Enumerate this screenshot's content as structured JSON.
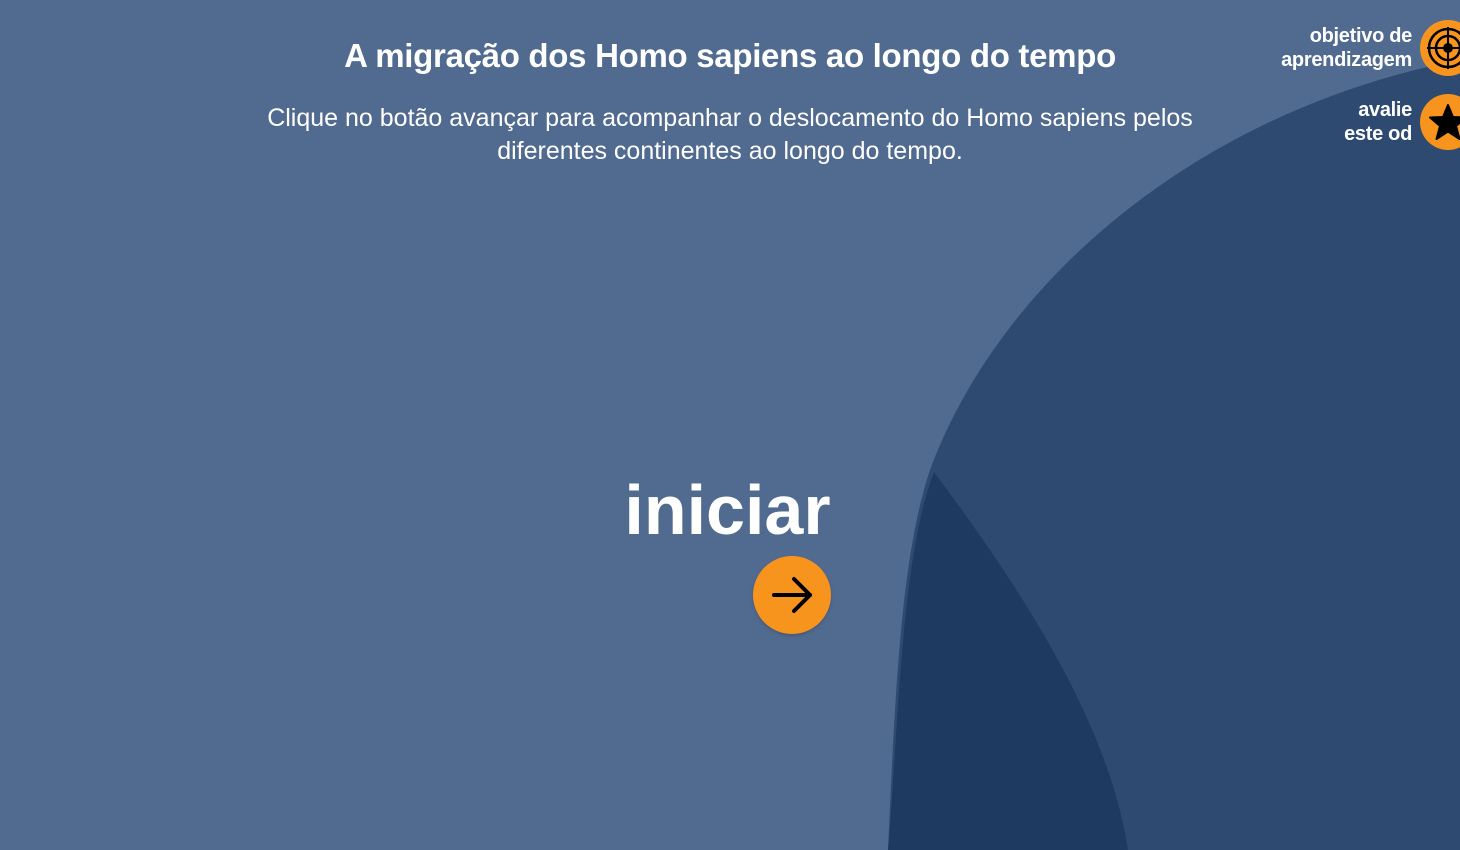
{
  "header": {
    "title": "A migração dos Homo sapiens ao longo do tempo",
    "instructions": "Clique no botão avançar para acompanhar o deslocamento do Homo sapiens pelos diferentes continentes ao longo do tempo."
  },
  "top_actions": {
    "objective": {
      "line1": "objetivo de",
      "line2": "aprendizagem",
      "icon": "target-icon"
    },
    "rate": {
      "line1": "avalie",
      "line2": "este od",
      "icon": "star-icon"
    }
  },
  "start": {
    "label": "iniciar",
    "button_icon": "arrow-right-icon"
  },
  "colors": {
    "background": "#516a8f",
    "shape_mid": "#2e4a70",
    "shape_dark": "#1f3a60",
    "accent": "#f7941d",
    "text": "#ffffff"
  }
}
